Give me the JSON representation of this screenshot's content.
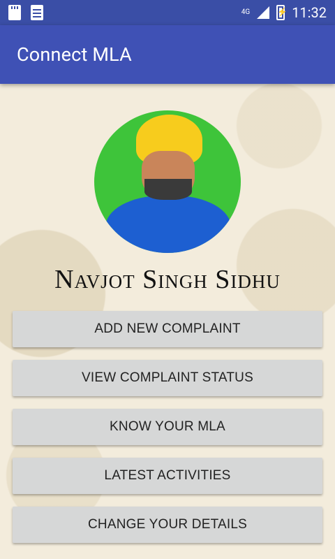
{
  "status_bar": {
    "network_type": "4G",
    "time": "11:32"
  },
  "app_bar": {
    "title": "Connect MLA"
  },
  "profile": {
    "name": "Navjot Singh Sidhu"
  },
  "buttons": [
    {
      "label": "ADD NEW COMPLAINT"
    },
    {
      "label": "VIEW COMPLAINT STATUS"
    },
    {
      "label": "KNOW YOUR MLA"
    },
    {
      "label": "LATEST ACTIVITIES"
    },
    {
      "label": "CHANGE YOUR DETAILS"
    }
  ],
  "colors": {
    "status_bar": "#3a4ea6",
    "app_bar": "#3f51b5",
    "button_bg": "#d6d7d7",
    "background": "#f3ecdc"
  }
}
